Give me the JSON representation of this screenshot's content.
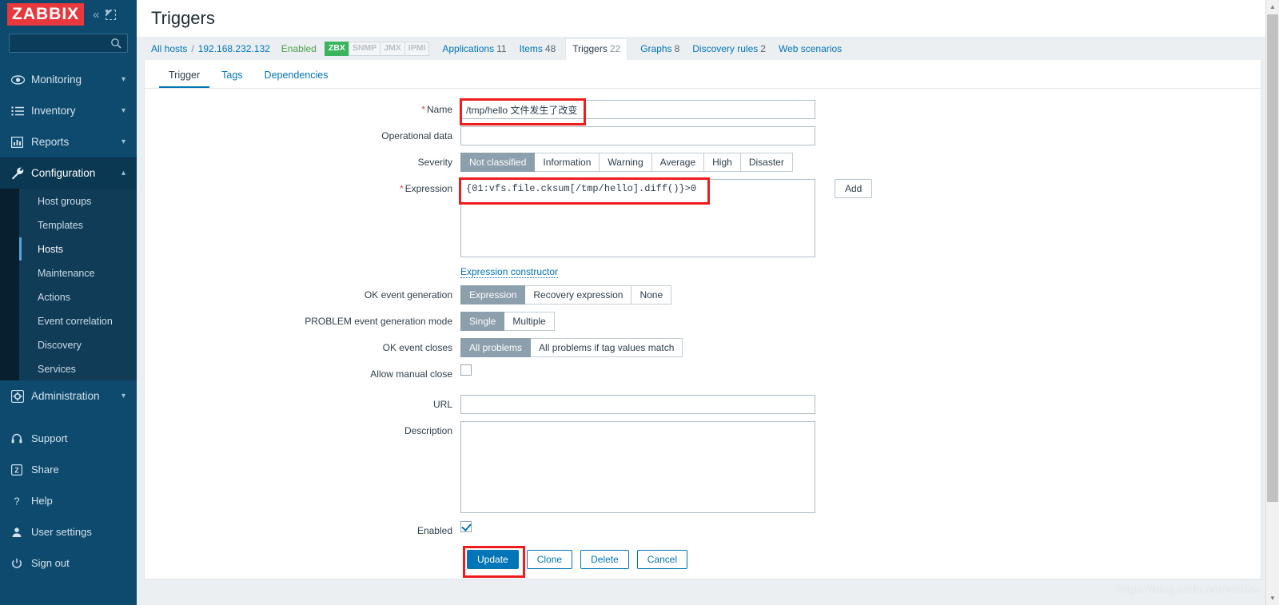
{
  "brand": {
    "logo": "ZABBIX",
    "collapse_icon": "«",
    "hide_icon": "hide-sidebar-icon"
  },
  "search": {
    "value": "",
    "placeholder": "",
    "icon": "search-icon"
  },
  "sidebar": {
    "main_items": [
      {
        "label": "Monitoring",
        "icon": "eye-icon",
        "chevron": "⌄",
        "state": "collapsed"
      },
      {
        "label": "Inventory",
        "icon": "list-icon",
        "chevron": "⌄",
        "state": "collapsed"
      },
      {
        "label": "Reports",
        "icon": "chart-icon",
        "chevron": "⌄",
        "state": "collapsed"
      },
      {
        "label": "Configuration",
        "icon": "wrench-icon",
        "chevron": "⌃",
        "state": "expanded"
      }
    ],
    "submenu": [
      {
        "label": "Host groups",
        "selected": false
      },
      {
        "label": "Templates",
        "selected": false
      },
      {
        "label": "Hosts",
        "selected": true
      },
      {
        "label": "Maintenance",
        "selected": false
      },
      {
        "label": "Actions",
        "selected": false
      },
      {
        "label": "Event correlation",
        "selected": false
      },
      {
        "label": "Discovery",
        "selected": false
      },
      {
        "label": "Services",
        "selected": false
      }
    ],
    "admin": {
      "label": "Administration",
      "icon": "gear-icon",
      "chevron": "⌄"
    },
    "lower_items": [
      {
        "label": "Support",
        "icon": "headset-icon"
      },
      {
        "label": "Share",
        "icon": "zabbix-share-icon"
      },
      {
        "label": "Help",
        "icon": "question-icon"
      },
      {
        "label": "User settings",
        "icon": "user-icon"
      },
      {
        "label": "Sign out",
        "icon": "power-icon"
      }
    ]
  },
  "header": {
    "title": "Triggers"
  },
  "breadcrumb": {
    "all_hosts": "All hosts",
    "separator": "/",
    "host": "192.168.232.132",
    "status": "Enabled",
    "badges": [
      {
        "label": "ZBX",
        "active": true
      },
      {
        "label": "SNMP",
        "active": false
      },
      {
        "label": "JMX",
        "active": false
      },
      {
        "label": "IPMI",
        "active": false
      }
    ],
    "links": [
      {
        "label": "Applications",
        "count": "11",
        "current": false
      },
      {
        "label": "Items",
        "count": "48",
        "current": false
      },
      {
        "label": "Triggers",
        "count": "22",
        "current": true
      },
      {
        "label": "Graphs",
        "count": "8",
        "current": false
      },
      {
        "label": "Discovery rules",
        "count": "2",
        "current": false
      },
      {
        "label": "Web scenarios",
        "count": "",
        "current": false
      }
    ]
  },
  "tabs": [
    {
      "label": "Trigger",
      "active": true
    },
    {
      "label": "Tags",
      "active": false
    },
    {
      "label": "Dependencies",
      "active": false
    }
  ],
  "form": {
    "name": {
      "label": "Name",
      "required": true,
      "value": "/tmp/hello 文件发生了改变",
      "placeholder": ""
    },
    "operational_data": {
      "label": "Operational data",
      "value": "",
      "placeholder": ""
    },
    "severity": {
      "label": "Severity",
      "options": [
        "Not classified",
        "Information",
        "Warning",
        "Average",
        "High",
        "Disaster"
      ],
      "selected": "Not classified"
    },
    "expression": {
      "label": "Expression",
      "required": true,
      "value": "{01:vfs.file.cksum[/tmp/hello].diff()}>0",
      "add_button": "Add",
      "constructor_link": "Expression constructor"
    },
    "ok_event_generation": {
      "label": "OK event generation",
      "options": [
        "Expression",
        "Recovery expression",
        "None"
      ],
      "selected": "Expression"
    },
    "problem_event_generation_mode": {
      "label": "PROBLEM event generation mode",
      "options": [
        "Single",
        "Multiple"
      ],
      "selected": "Single"
    },
    "ok_event_closes": {
      "label": "OK event closes",
      "options": [
        "All problems",
        "All problems if tag values match"
      ],
      "selected": "All problems"
    },
    "allow_manual_close": {
      "label": "Allow manual close",
      "checked": false
    },
    "url": {
      "label": "URL",
      "value": "",
      "placeholder": ""
    },
    "description": {
      "label": "Description",
      "value": "",
      "placeholder": ""
    },
    "enabled": {
      "label": "Enabled",
      "checked": true
    }
  },
  "buttons": {
    "update": "Update",
    "clone": "Clone",
    "delete": "Delete",
    "cancel": "Cancel"
  },
  "watermark": "https://blog.csdn.net/Insistw",
  "colors": {
    "sidebar_bg": "#0e4a6e",
    "submenu_bg": "#113c58",
    "accent_link": "#0275b8",
    "brand_red": "#e8373d",
    "highlight_red": "#ee1c1c",
    "zbx_green": "#3bb45f",
    "segment_selected": "#8c9fac"
  }
}
